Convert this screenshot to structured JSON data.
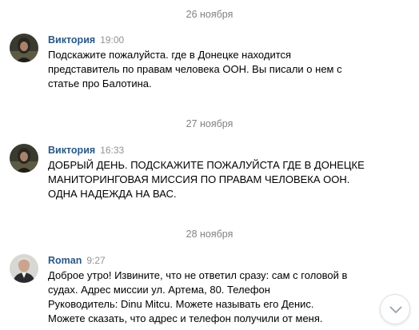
{
  "days": [
    {
      "date_label": "26 ноября",
      "message": {
        "author": "Виктория",
        "time": "19:00",
        "avatar_icon": "user-photo-icon",
        "lines": [
          "Подскажите пожалуйста. где в Донецке находится",
          "представитель по правам человека ООН. Вы писали о нем с",
          "статье про Балотина."
        ]
      }
    },
    {
      "date_label": "27 ноября",
      "message": {
        "author": "Виктория",
        "time": "16:33",
        "avatar_icon": "user-photo-icon",
        "lines": [
          "ДОБРЫЙ ДЕНЬ. ПОДСКАЖИТЕ ПОЖАЛУЙСТА ГДЕ В ДОНЕЦКЕ",
          "МАНИТОРИНГОВАЯ МИССИЯ ПО ПРАВАМ ЧЕЛОВЕКА ООН.",
          "ОДНА НАДЕЖДА НА ВАС."
        ]
      }
    },
    {
      "date_label": "28 ноября",
      "message": {
        "author": "Roman",
        "time": "9:27",
        "avatar_icon": "user-photo-icon",
        "lines": [
          "Доброе утро! Извините, что не ответил сразу: сам с головой в",
          "судах. Адрес миссии ул. Артема, 80. Телефон",
          "Руководитель: Dinu Mitcu. Можете называть его Денис.",
          "Можете сказать, что адрес и телефон получили от меня."
        ]
      }
    }
  ],
  "scroll_button": {
    "icon": "chevron-down-icon"
  },
  "colors": {
    "author": "#2a5885",
    "time": "#939393",
    "date_divider": "#828282",
    "text": "#000000"
  }
}
